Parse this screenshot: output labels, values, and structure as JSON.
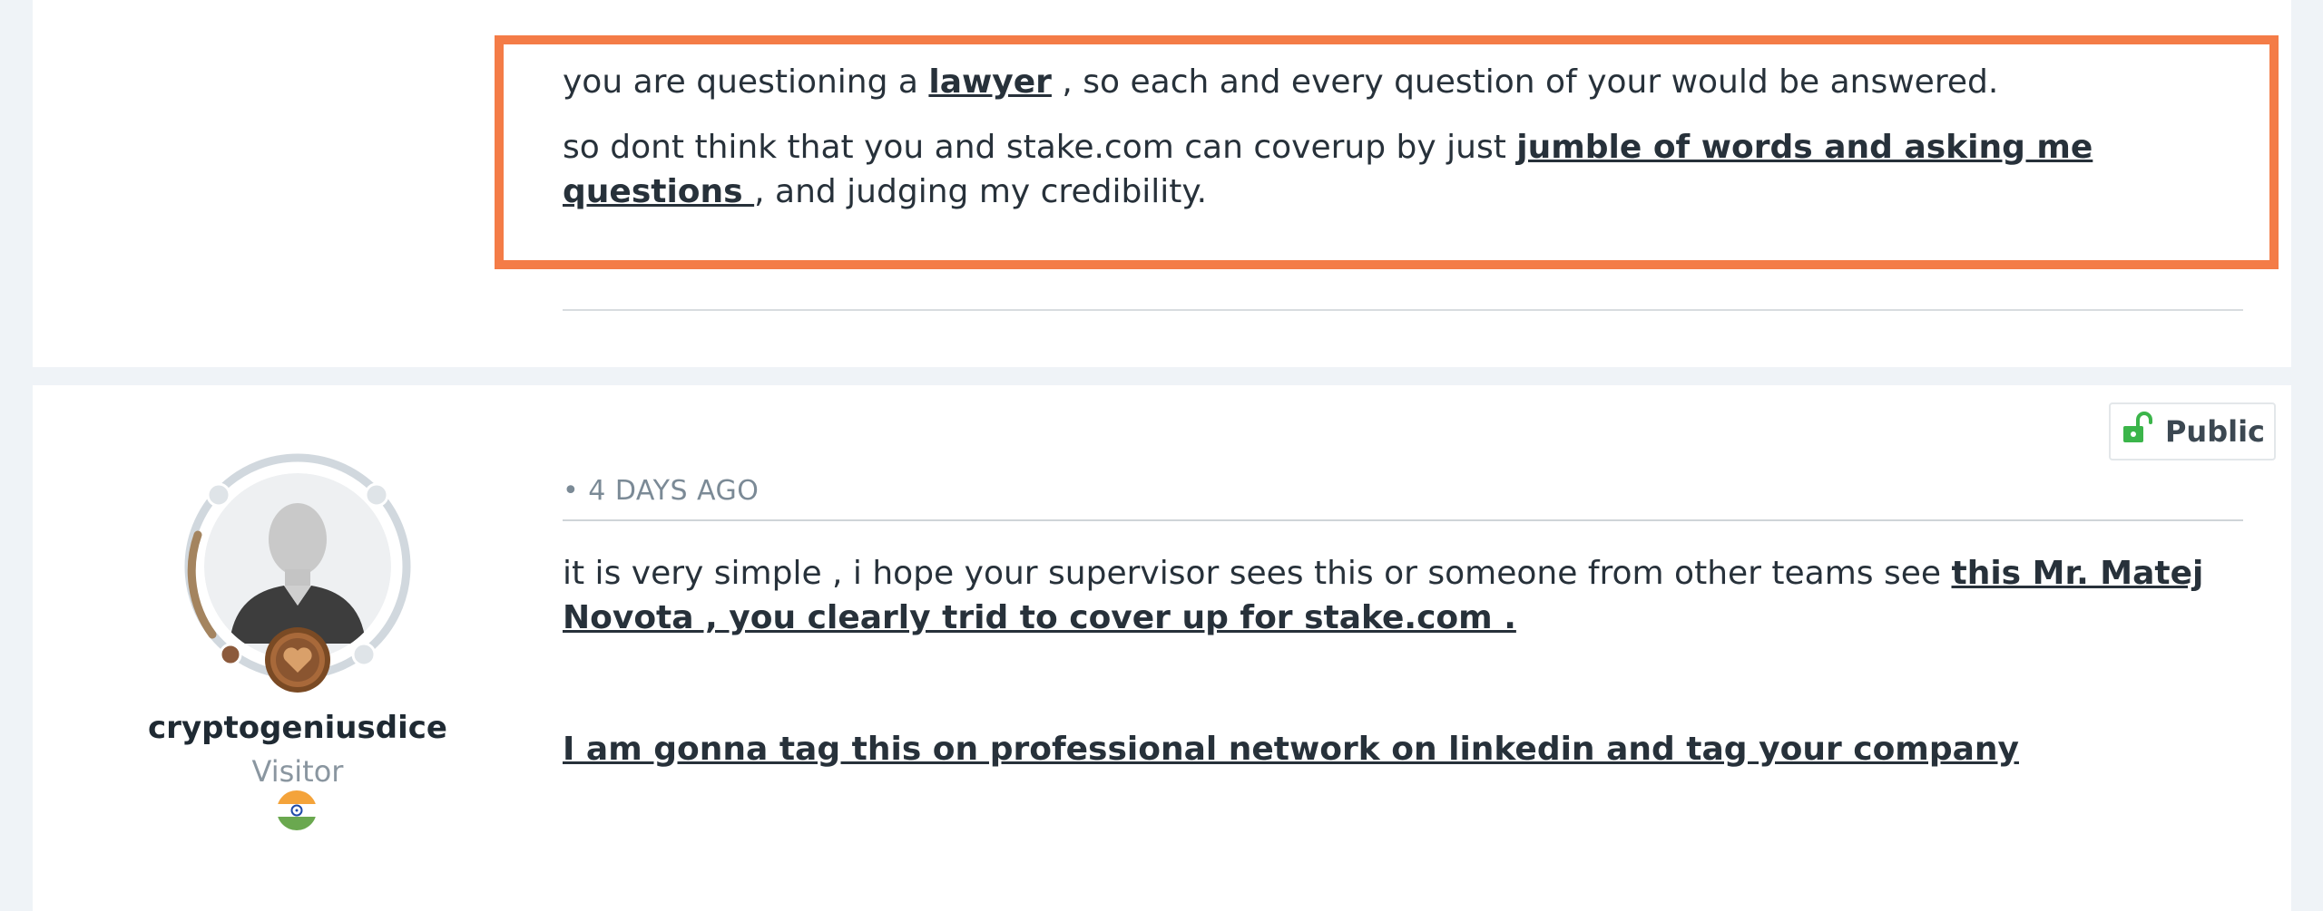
{
  "previous_post": {
    "line1_before": "you are questioning a ",
    "line1_link": "lawyer",
    "line1_after": " , so each and every question of your would be answered.",
    "line2_before": "so dont think that you and stake.com can coverup by just ",
    "line2_link": "jumble of words and asking me questions ",
    "line2_after": ", and judging my credibility."
  },
  "post": {
    "visibility_label": "Public",
    "visibility_icon": "unlock-icon",
    "timestamp": "• 4 DAYS AGO",
    "body_line1_before": "it is very simple , i hope your supervisor sees this or someone from other teams see ",
    "body_line1_link": "this Mr. Matej Novota , you clearly trid to cover up for stake.com .",
    "body_line2_link": "I am gonna tag this on professional network on linkedin and tag your company"
  },
  "author": {
    "username": "cryptogeniusdice",
    "role": "Visitor",
    "avatar_icon": "user-avatar-icon",
    "rank_badge_icon": "bronze-heart-badge-icon",
    "flag_icon": "india-flag-icon"
  },
  "colors": {
    "highlight_border": "#f47c47",
    "page_background": "#eff3f7",
    "public_icon": "#3bb54a",
    "rank_ring": "#a4845f"
  }
}
